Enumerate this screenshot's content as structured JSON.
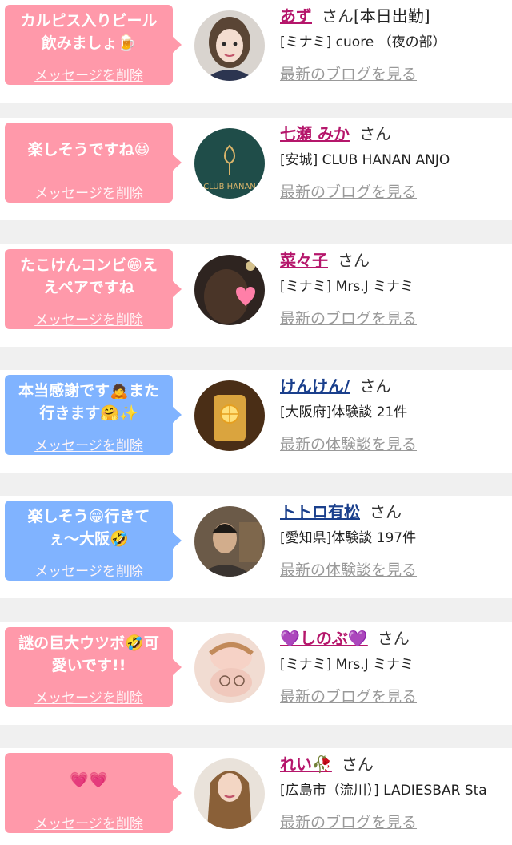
{
  "cards": [
    {
      "message_lines": [
        "カルピス入りビール",
        "飲みましょ🍺"
      ],
      "delete_label": "メッセージを削除",
      "name": "あず",
      "honorific": "さん",
      "tag": "[本日出勤]",
      "info": "[ミナミ] cuore （夜の部）",
      "link": "最新のブログを見る",
      "bubble_color": "pink"
    },
    {
      "message_lines": [
        "楽しそうですね😆"
      ],
      "delete_label": "メッセージを削除",
      "name": "七瀬 みか",
      "honorific": "さん",
      "tag": "",
      "info": "[安城] CLUB HANAN ANJO",
      "link": "最新のブログを見る",
      "bubble_color": "pink"
    },
    {
      "message_lines": [
        "たこけんコンビ😁え",
        "えペアですね"
      ],
      "delete_label": "メッセージを削除",
      "name": "菜々子",
      "honorific": "さん",
      "tag": "",
      "info": "[ミナミ] Mrs.J ミナミ",
      "link": "最新のブログを見る",
      "bubble_color": "pink"
    },
    {
      "message_lines": [
        "本当感謝です🙇また",
        "行きます🤗✨"
      ],
      "delete_label": "メッセージを削除",
      "name": "けんけん/",
      "honorific": "さん",
      "tag": "",
      "info": "[大阪府]体験談 21件",
      "link": "最新の体験談を見る",
      "bubble_color": "blue"
    },
    {
      "message_lines": [
        "楽しそう😁行きて",
        "ぇ〜大阪🤣"
      ],
      "delete_label": "メッセージを削除",
      "name": "トトロ有松",
      "honorific": "さん",
      "tag": "",
      "info": "[愛知県]体験談 197件",
      "link": "最新の体験談を見る",
      "bubble_color": "blue"
    },
    {
      "message_lines": [
        "謎の巨大ウツボ🤣可",
        "愛いです!!"
      ],
      "delete_label": "メッセージを削除",
      "name": "💜しのぶ💜",
      "honorific": "さん",
      "tag": "",
      "info": "[ミナミ] Mrs.J ミナミ",
      "link": "最新のブログを見る",
      "bubble_color": "pink"
    },
    {
      "message_lines": [
        "💗💗"
      ],
      "delete_label": "メッセージを削除",
      "name": "れい🥀",
      "honorific": "さん",
      "tag": "",
      "info": "[広島市（流川）] LADIESBAR Sta",
      "link": "最新のブログを見る",
      "bubble_color": "pink"
    }
  ],
  "avatar_icons": [
    "woman-portrait-icon",
    "club-logo-icon",
    "woman-heart-sticker-icon",
    "drink-glass-icon",
    "man-portrait-icon",
    "woman-double-exposure-icon",
    "woman-long-hair-icon"
  ],
  "avatar_logo_text": "CLUB HANAN",
  "colors": {
    "pink_bubble": "#ff99aa",
    "blue_bubble": "#80b3ff",
    "pink_name": "#b5166b",
    "blue_name": "#1a3f8c",
    "link_gray": "#999999"
  }
}
